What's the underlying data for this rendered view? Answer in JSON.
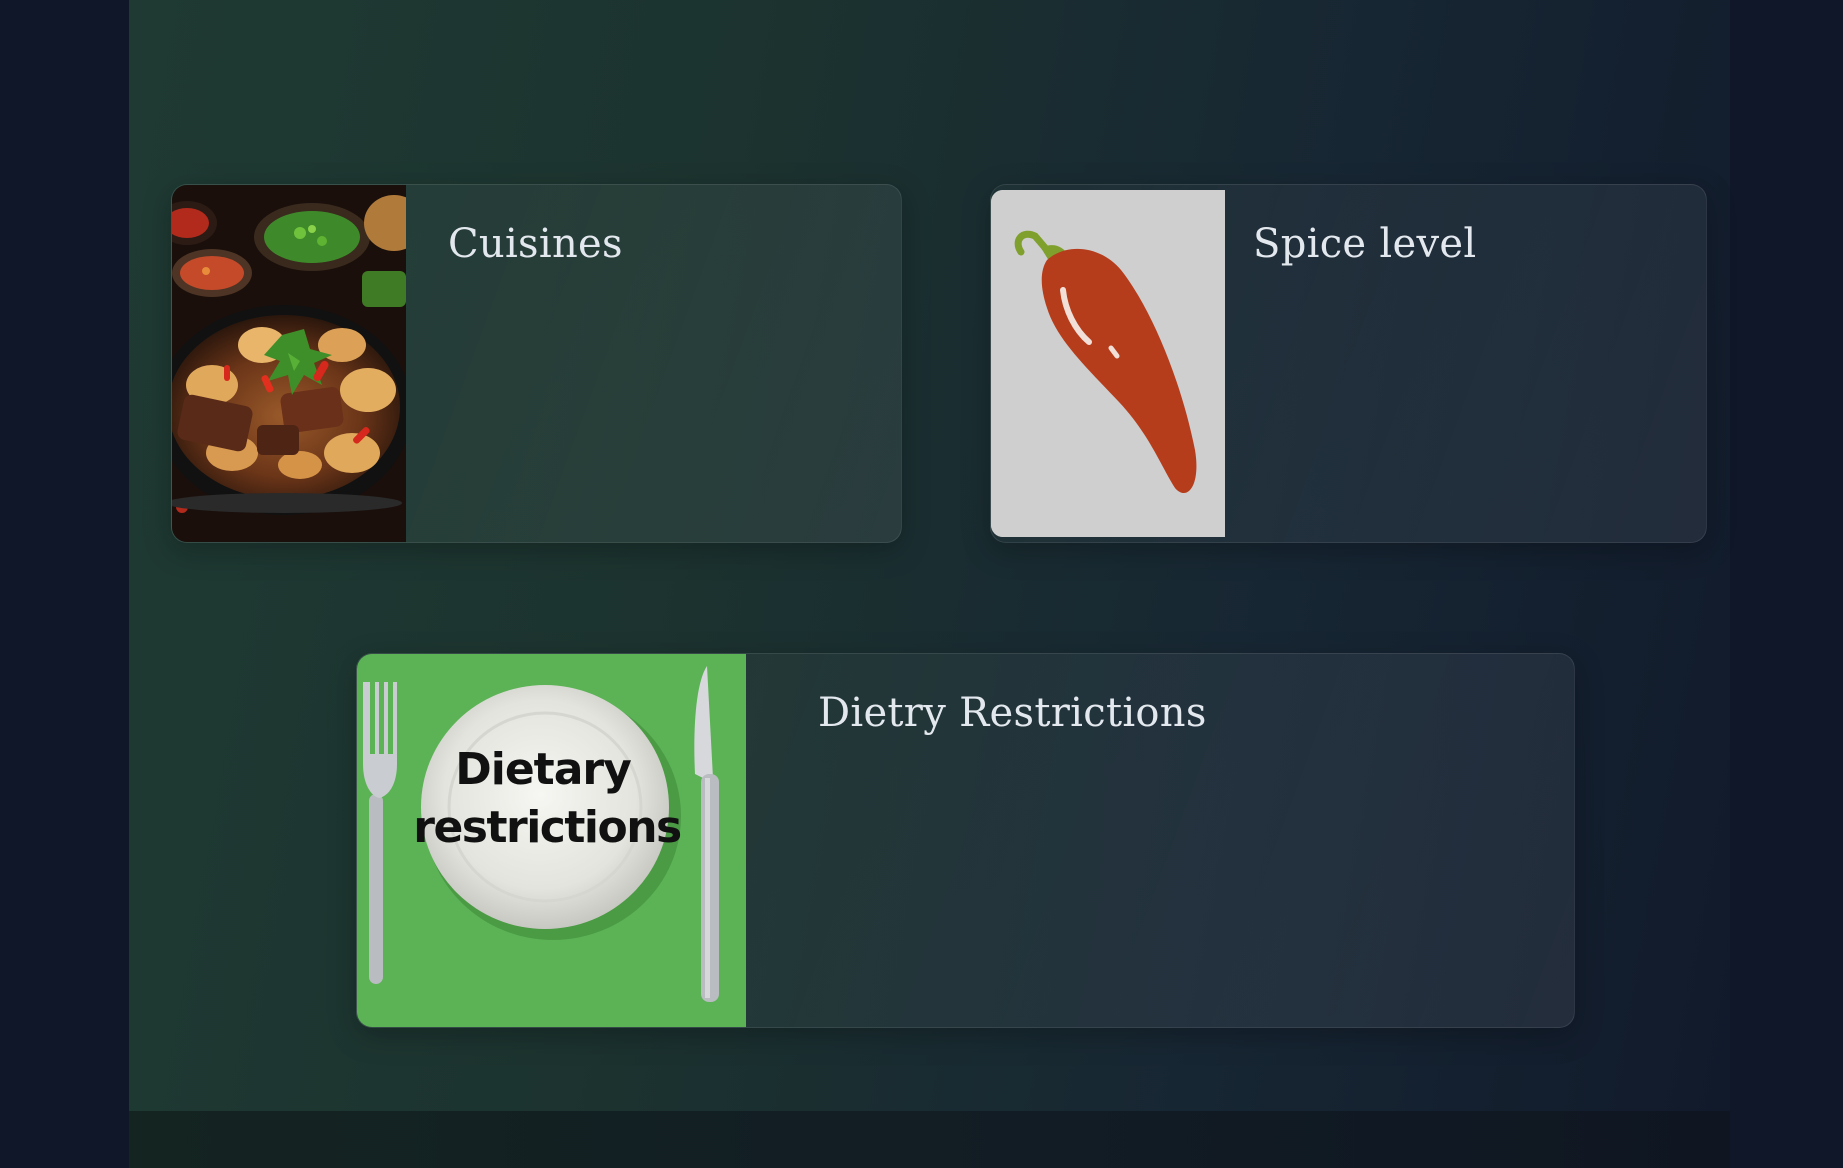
{
  "cards": [
    {
      "title": "Cuisines",
      "image": "asian-cuisine-photo"
    },
    {
      "title": "Spice level",
      "image": "chili-pepper-icon"
    },
    {
      "title": "Dietry Restrictions",
      "image": "dietary-restrictions-plate-photo",
      "image_text": "Dietary restrictions"
    }
  ],
  "colors": {
    "page_bg": "#0f1729",
    "panel_green": "#1f3a33",
    "panel_navy": "#111a2b",
    "title_text": "#e3e8ee",
    "chili_red": "#b63d1b",
    "chili_stem": "#7fa02c",
    "placemat_green": "#5cb356"
  }
}
